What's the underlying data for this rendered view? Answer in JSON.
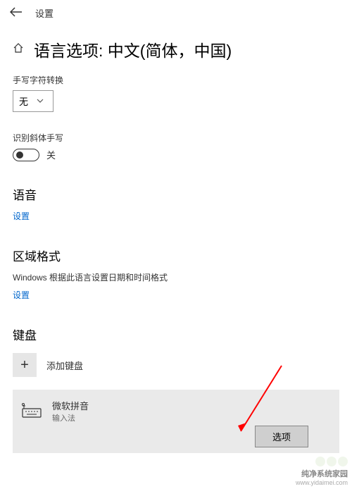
{
  "header": {
    "app_title": "设置"
  },
  "page": {
    "title": "语言选项: 中文(简体，中国)"
  },
  "handwriting": {
    "conversion_label": "手写字符转换",
    "conversion_value": "无",
    "italic_label": "识别斜体手写",
    "italic_state": "关"
  },
  "speech": {
    "heading": "语音",
    "link": "设置"
  },
  "region": {
    "heading": "区域格式",
    "desc": "Windows 根据此语言设置日期和时间格式",
    "link": "设置"
  },
  "keyboard": {
    "heading": "键盘",
    "add_label": "添加键盘",
    "item": {
      "name": "微软拼音",
      "sub": "输入法",
      "options_button": "选项"
    }
  },
  "watermark": {
    "text": "纯净系统家园",
    "url": "www.yidaimei.com"
  }
}
